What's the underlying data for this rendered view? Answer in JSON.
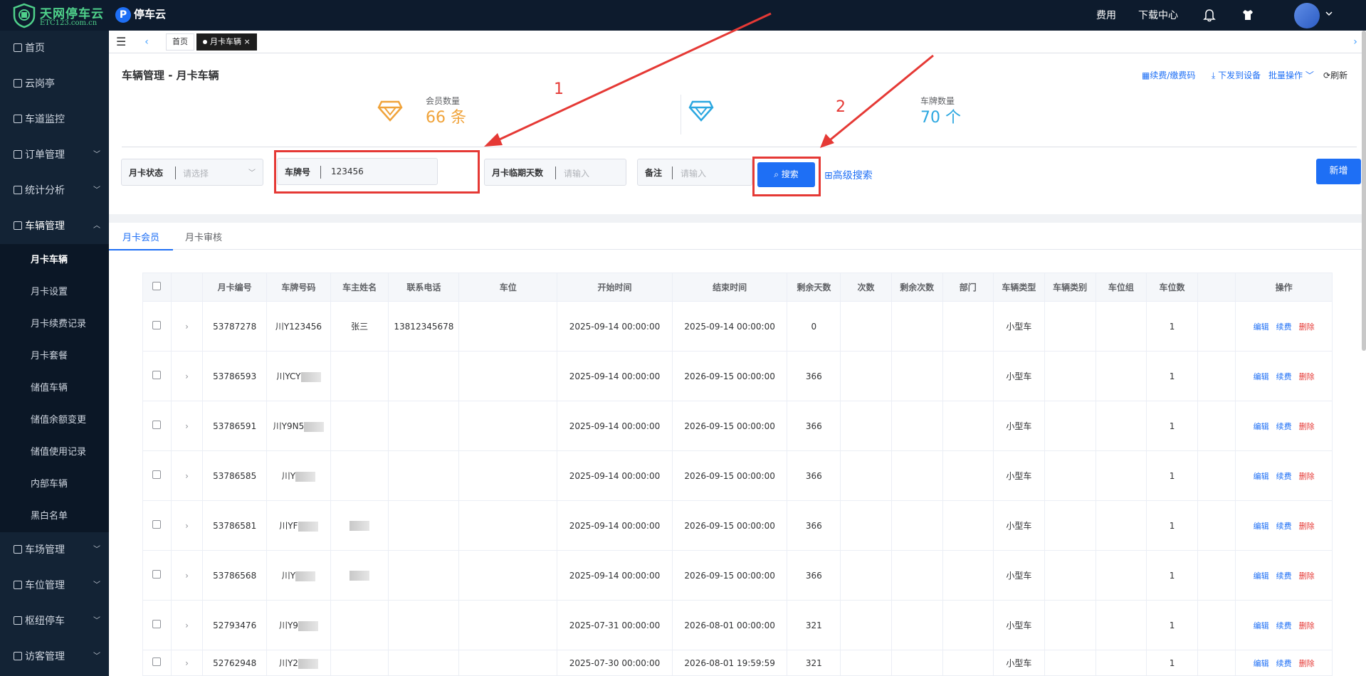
{
  "logo": {
    "line1": "天网停车云",
    "line2": "ETC123.com.cn"
  },
  "brand": {
    "p": "P",
    "name": "停车云"
  },
  "topnav": {
    "fees": "费用",
    "download": "下载中心"
  },
  "sidebar": {
    "items": [
      {
        "label": "首页"
      },
      {
        "label": "云岗亭"
      },
      {
        "label": "车道监控"
      },
      {
        "label": "订单管理"
      },
      {
        "label": "统计分析"
      },
      {
        "label": "车辆管理"
      },
      {
        "label": "车场管理"
      },
      {
        "label": "车位管理"
      },
      {
        "label": "枢纽停车"
      },
      {
        "label": "访客管理"
      }
    ],
    "sub": [
      {
        "label": "月卡车辆"
      },
      {
        "label": "月卡设置"
      },
      {
        "label": "月卡续费记录"
      },
      {
        "label": "月卡套餐"
      },
      {
        "label": "储值车辆"
      },
      {
        "label": "储值余额变更"
      },
      {
        "label": "储值使用记录"
      },
      {
        "label": "内部车辆"
      },
      {
        "label": "黑白名单"
      }
    ]
  },
  "tabs": {
    "home": "首页",
    "current": "月卡车辆",
    "close": "×"
  },
  "page": {
    "title": "车辆管理 - 月卡车辆",
    "renew_link": "续费/缴费码",
    "download_link": "下发到设备",
    "batch": "批量操作",
    "refresh": "刷新"
  },
  "stats": {
    "members_label": "会员数量",
    "members_value": "66 条",
    "plates_label": "车牌数量",
    "plates_value": "70 个"
  },
  "filters": {
    "status_label": "月卡状态",
    "status_placeholder": "请选择",
    "plate_label": "车牌号",
    "plate_value": "123456",
    "days_label": "月卡临期天数",
    "days_placeholder": "请输入",
    "note_label": "备注",
    "note_placeholder": "请输入",
    "search": "搜索",
    "advanced": "高级搜索",
    "add": "新增"
  },
  "annotations": {
    "one": "1",
    "two": "2"
  },
  "subtabs": {
    "members": "月卡会员",
    "review": "月卡审核"
  },
  "table": {
    "headers": [
      "月卡编号",
      "车牌号码",
      "车主姓名",
      "联系电话",
      "车位",
      "开始时间",
      "结束时间",
      "剩余天数",
      "次数",
      "剩余次数",
      "部门",
      "车辆类型",
      "车辆类别",
      "车位组",
      "车位数",
      "操作"
    ],
    "actions": {
      "edit": "编辑",
      "renew": "续费",
      "delete": "删除"
    },
    "rows": [
      {
        "id": "53787278",
        "plate": "川Y123456",
        "owner": "张三",
        "phone": "13812345678",
        "start": "2025-09-14 00:00:00",
        "end": "2025-09-14 00:00:00",
        "days": "0",
        "type": "小型车",
        "count": "1"
      },
      {
        "id": "53786593",
        "plate": "川YCY",
        "owner": "",
        "phone": "",
        "start": "2025-09-14 00:00:00",
        "end": "2026-09-15 00:00:00",
        "days": "366",
        "type": "小型车",
        "count": "1"
      },
      {
        "id": "53786591",
        "plate": "川Y9N5",
        "owner": "",
        "phone": "",
        "start": "2025-09-14 00:00:00",
        "end": "2026-09-15 00:00:00",
        "days": "366",
        "type": "小型车",
        "count": "1"
      },
      {
        "id": "53786585",
        "plate": "川Y",
        "owner": "",
        "phone": "",
        "start": "2025-09-14 00:00:00",
        "end": "2026-09-15 00:00:00",
        "days": "366",
        "type": "小型车",
        "count": "1"
      },
      {
        "id": "53786581",
        "plate": "川YF",
        "owner": "",
        "phone": "",
        "start": "2025-09-14 00:00:00",
        "end": "2026-09-15 00:00:00",
        "days": "366",
        "type": "小型车",
        "count": "1"
      },
      {
        "id": "53786568",
        "plate": "川Y",
        "owner": "",
        "phone": "",
        "start": "2025-09-14 00:00:00",
        "end": "2026-09-15 00:00:00",
        "days": "366",
        "type": "小型车",
        "count": "1"
      },
      {
        "id": "52793476",
        "plate": "川Y9",
        "owner": "",
        "phone": "",
        "start": "2025-07-31 00:00:00",
        "end": "2026-08-01 00:00:00",
        "days": "321",
        "type": "小型车",
        "count": "1"
      },
      {
        "id": "52762948",
        "plate": "川Y2",
        "owner": "",
        "phone": "",
        "start": "2025-07-30 00:00:00",
        "end": "2026-08-01 19:59:59",
        "days": "321",
        "type": "小型车",
        "count": "1"
      }
    ]
  }
}
